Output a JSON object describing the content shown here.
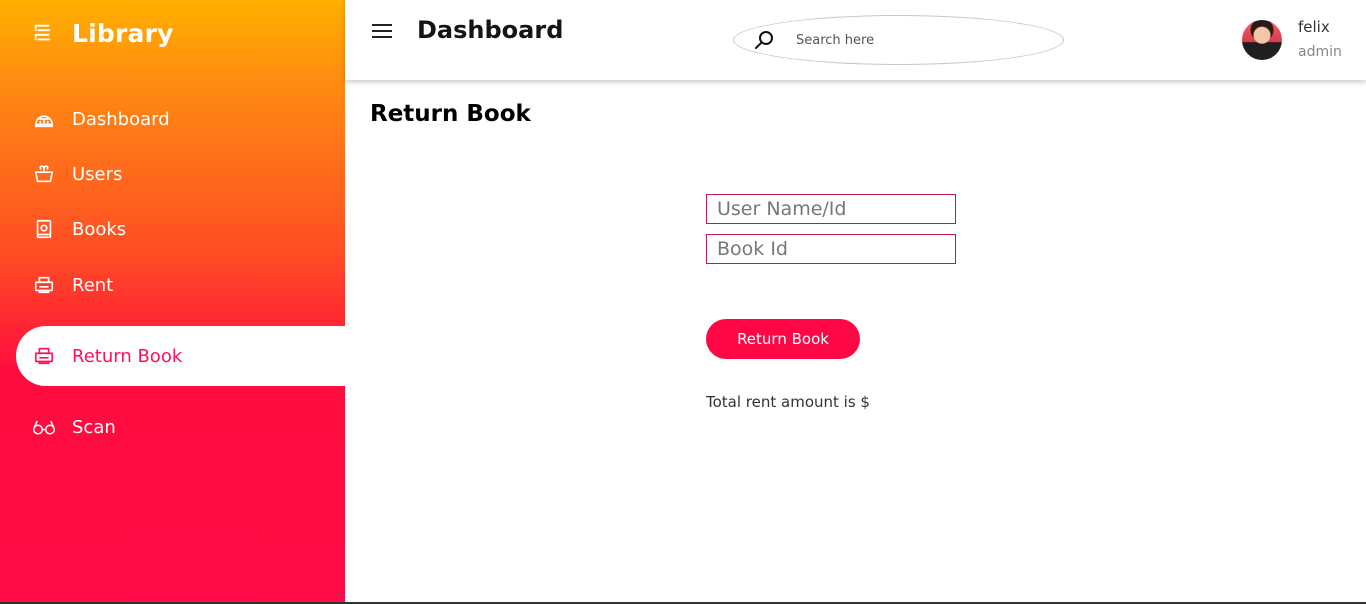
{
  "sidebar": {
    "brand": {
      "title": "Library",
      "icon": "books-stack-icon"
    },
    "items": [
      {
        "label": "Dashboard",
        "icon": "dashboard-dome-icon",
        "active": false
      },
      {
        "label": "Users",
        "icon": "gift-basket-icon",
        "active": false
      },
      {
        "label": "Books",
        "icon": "book-icon",
        "active": false
      },
      {
        "label": "Rent",
        "icon": "printer-icon",
        "active": false
      },
      {
        "label": "Return Book",
        "icon": "printer-icon",
        "active": true
      },
      {
        "label": "Scan",
        "icon": "glasses-icon",
        "active": false
      }
    ]
  },
  "topbar": {
    "title": "Dashboard",
    "search": {
      "placeholder": "Search here",
      "value": ""
    },
    "user": {
      "name": "felix",
      "role": "admin"
    }
  },
  "main": {
    "title": "Return Book",
    "form": {
      "user_placeholder": "User Name/Id",
      "book_placeholder": "Book Id",
      "submit_label": "Return Book"
    },
    "total_text": "Total rent amount is $"
  },
  "colors": {
    "accent": "#ff0745",
    "active_text": "#ff1058",
    "gradient_top": "#ffb000",
    "gradient_bottom": "#ff0b47"
  }
}
